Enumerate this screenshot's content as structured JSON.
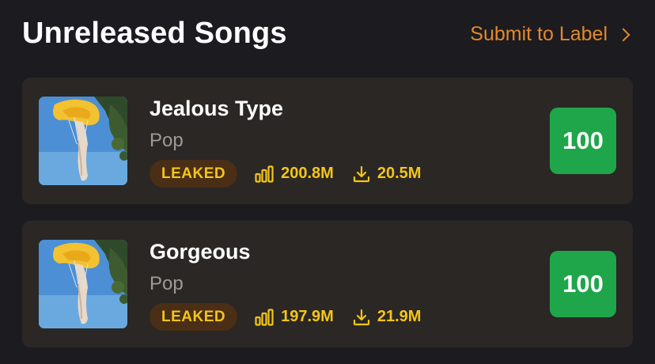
{
  "header": {
    "title": "Unreleased Songs",
    "submit_label": "Submit to Label"
  },
  "colors": {
    "background": "#1c1b1f",
    "card": "#2a2725",
    "accent_orange": "#e3892a",
    "leaked_text": "#f5c518",
    "leaked_bg": "#4a2e16",
    "score_green": "#1fa64a"
  },
  "songs": [
    {
      "name": "Jealous Type",
      "genre": "Pop",
      "badge": "LEAKED",
      "streams": "200.8M",
      "downloads": "20.5M",
      "score": "100",
      "icons": [
        "album-cover-image",
        "bar-chart-icon",
        "download-icon"
      ]
    },
    {
      "name": "Gorgeous",
      "genre": "Pop",
      "badge": "LEAKED",
      "streams": "197.9M",
      "downloads": "21.9M",
      "score": "100",
      "icons": [
        "album-cover-image",
        "bar-chart-icon",
        "download-icon"
      ]
    }
  ]
}
